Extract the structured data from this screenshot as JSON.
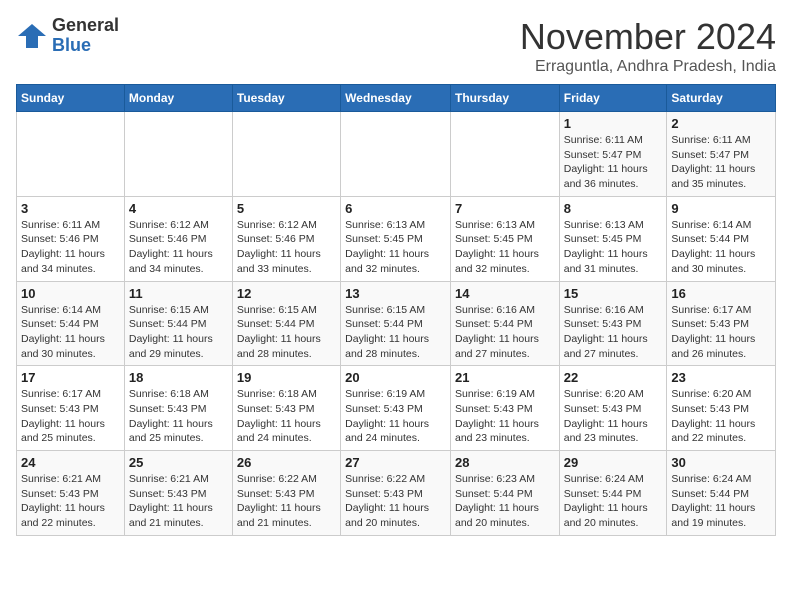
{
  "logo": {
    "general": "General",
    "blue": "Blue"
  },
  "title": "November 2024",
  "location": "Erraguntla, Andhra Pradesh, India",
  "headers": [
    "Sunday",
    "Monday",
    "Tuesday",
    "Wednesday",
    "Thursday",
    "Friday",
    "Saturday"
  ],
  "weeks": [
    [
      {
        "day": "",
        "info": ""
      },
      {
        "day": "",
        "info": ""
      },
      {
        "day": "",
        "info": ""
      },
      {
        "day": "",
        "info": ""
      },
      {
        "day": "",
        "info": ""
      },
      {
        "day": "1",
        "info": "Sunrise: 6:11 AM\nSunset: 5:47 PM\nDaylight: 11 hours\nand 36 minutes."
      },
      {
        "day": "2",
        "info": "Sunrise: 6:11 AM\nSunset: 5:47 PM\nDaylight: 11 hours\nand 35 minutes."
      }
    ],
    [
      {
        "day": "3",
        "info": "Sunrise: 6:11 AM\nSunset: 5:46 PM\nDaylight: 11 hours\nand 34 minutes."
      },
      {
        "day": "4",
        "info": "Sunrise: 6:12 AM\nSunset: 5:46 PM\nDaylight: 11 hours\nand 34 minutes."
      },
      {
        "day": "5",
        "info": "Sunrise: 6:12 AM\nSunset: 5:46 PM\nDaylight: 11 hours\nand 33 minutes."
      },
      {
        "day": "6",
        "info": "Sunrise: 6:13 AM\nSunset: 5:45 PM\nDaylight: 11 hours\nand 32 minutes."
      },
      {
        "day": "7",
        "info": "Sunrise: 6:13 AM\nSunset: 5:45 PM\nDaylight: 11 hours\nand 32 minutes."
      },
      {
        "day": "8",
        "info": "Sunrise: 6:13 AM\nSunset: 5:45 PM\nDaylight: 11 hours\nand 31 minutes."
      },
      {
        "day": "9",
        "info": "Sunrise: 6:14 AM\nSunset: 5:44 PM\nDaylight: 11 hours\nand 30 minutes."
      }
    ],
    [
      {
        "day": "10",
        "info": "Sunrise: 6:14 AM\nSunset: 5:44 PM\nDaylight: 11 hours\nand 30 minutes."
      },
      {
        "day": "11",
        "info": "Sunrise: 6:15 AM\nSunset: 5:44 PM\nDaylight: 11 hours\nand 29 minutes."
      },
      {
        "day": "12",
        "info": "Sunrise: 6:15 AM\nSunset: 5:44 PM\nDaylight: 11 hours\nand 28 minutes."
      },
      {
        "day": "13",
        "info": "Sunrise: 6:15 AM\nSunset: 5:44 PM\nDaylight: 11 hours\nand 28 minutes."
      },
      {
        "day": "14",
        "info": "Sunrise: 6:16 AM\nSunset: 5:44 PM\nDaylight: 11 hours\nand 27 minutes."
      },
      {
        "day": "15",
        "info": "Sunrise: 6:16 AM\nSunset: 5:43 PM\nDaylight: 11 hours\nand 27 minutes."
      },
      {
        "day": "16",
        "info": "Sunrise: 6:17 AM\nSunset: 5:43 PM\nDaylight: 11 hours\nand 26 minutes."
      }
    ],
    [
      {
        "day": "17",
        "info": "Sunrise: 6:17 AM\nSunset: 5:43 PM\nDaylight: 11 hours\nand 25 minutes."
      },
      {
        "day": "18",
        "info": "Sunrise: 6:18 AM\nSunset: 5:43 PM\nDaylight: 11 hours\nand 25 minutes."
      },
      {
        "day": "19",
        "info": "Sunrise: 6:18 AM\nSunset: 5:43 PM\nDaylight: 11 hours\nand 24 minutes."
      },
      {
        "day": "20",
        "info": "Sunrise: 6:19 AM\nSunset: 5:43 PM\nDaylight: 11 hours\nand 24 minutes."
      },
      {
        "day": "21",
        "info": "Sunrise: 6:19 AM\nSunset: 5:43 PM\nDaylight: 11 hours\nand 23 minutes."
      },
      {
        "day": "22",
        "info": "Sunrise: 6:20 AM\nSunset: 5:43 PM\nDaylight: 11 hours\nand 23 minutes."
      },
      {
        "day": "23",
        "info": "Sunrise: 6:20 AM\nSunset: 5:43 PM\nDaylight: 11 hours\nand 22 minutes."
      }
    ],
    [
      {
        "day": "24",
        "info": "Sunrise: 6:21 AM\nSunset: 5:43 PM\nDaylight: 11 hours\nand 22 minutes."
      },
      {
        "day": "25",
        "info": "Sunrise: 6:21 AM\nSunset: 5:43 PM\nDaylight: 11 hours\nand 21 minutes."
      },
      {
        "day": "26",
        "info": "Sunrise: 6:22 AM\nSunset: 5:43 PM\nDaylight: 11 hours\nand 21 minutes."
      },
      {
        "day": "27",
        "info": "Sunrise: 6:22 AM\nSunset: 5:43 PM\nDaylight: 11 hours\nand 20 minutes."
      },
      {
        "day": "28",
        "info": "Sunrise: 6:23 AM\nSunset: 5:44 PM\nDaylight: 11 hours\nand 20 minutes."
      },
      {
        "day": "29",
        "info": "Sunrise: 6:24 AM\nSunset: 5:44 PM\nDaylight: 11 hours\nand 20 minutes."
      },
      {
        "day": "30",
        "info": "Sunrise: 6:24 AM\nSunset: 5:44 PM\nDaylight: 11 hours\nand 19 minutes."
      }
    ]
  ]
}
